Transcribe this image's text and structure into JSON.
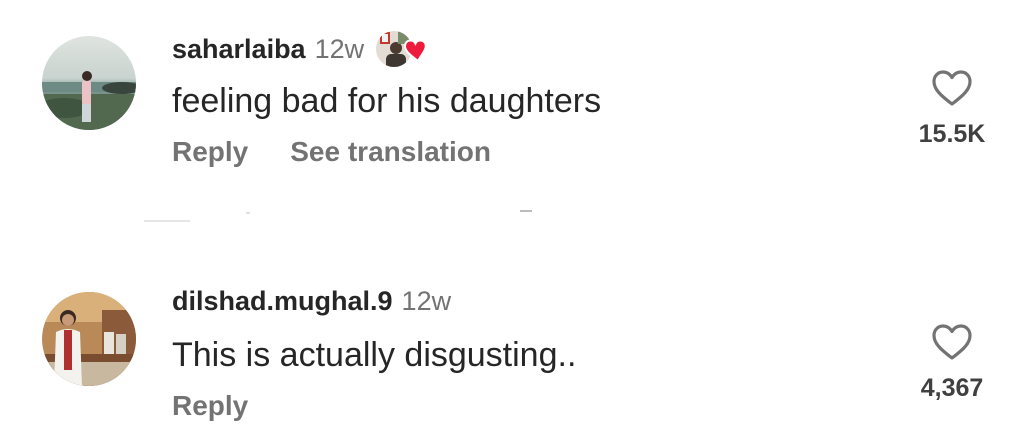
{
  "comments": [
    {
      "username": "saharlaiba",
      "timestamp": "12w",
      "text": "feeling bad for his daughters",
      "actions": {
        "reply": "Reply",
        "translate": "See translation"
      },
      "likes": "15.5K",
      "avatar_icon": "beach-profile-photo",
      "creator_liked": true
    },
    {
      "username": "dilshad.mughal.9",
      "timestamp": "12w",
      "text": "This is actually disgusting..",
      "actions": {
        "reply": "Reply"
      },
      "likes": "4,367",
      "avatar_icon": "woman-profile-photo",
      "creator_liked": false
    }
  ],
  "colors": {
    "primary_text": "#262626",
    "secondary_text": "#737373",
    "like_heart_badge": "#ed1c3c"
  }
}
